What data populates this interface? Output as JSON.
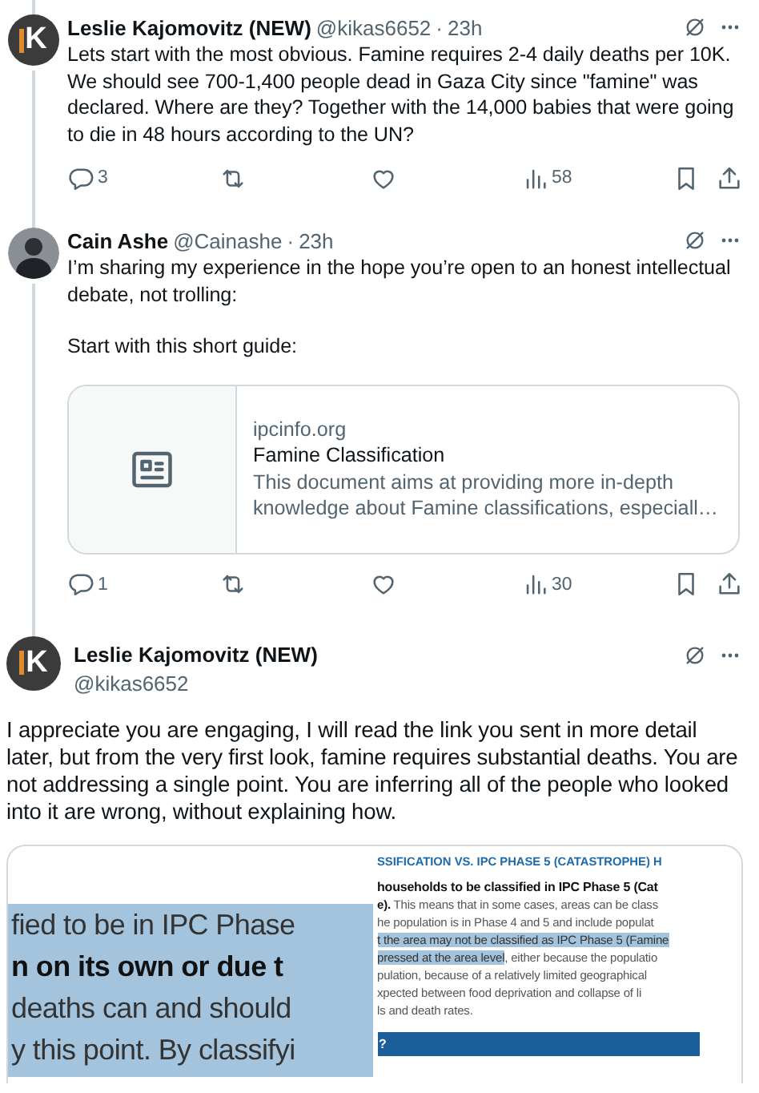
{
  "tweets": [
    {
      "kind": "reply",
      "author": "Leslie Kajomovitz (NEW)",
      "handle": "@kikas6652",
      "separator": "·",
      "time": "23h",
      "avatar": {
        "kind": "logo",
        "mark": "K"
      },
      "paragraphs": [
        "Lets start with the most obvious. Famine requires 2-4 daily deaths per 10K. We should see 700-1,400 people dead in Gaza City since \"famine\" was declared. Where are they? Together with the 14,000 babies that were going to die in 48 hours according to the UN?"
      ],
      "stats": {
        "replies": "3",
        "views": "58"
      }
    },
    {
      "kind": "reply",
      "author": "Cain Ashe",
      "handle": "@Cainashe",
      "separator": "·",
      "time": "23h",
      "avatar": {
        "kind": "photo"
      },
      "paragraphs": [
        "I’m sharing my experience in the hope you’re open to an honest intellectual debate, not trolling:",
        "Start with this short guide:"
      ],
      "link_card": {
        "domain": "ipcinfo.org",
        "title": "Famine Classification",
        "description": "This document aims at providing more in-depth knowledge about Famine classifications, especiall…"
      },
      "stats": {
        "replies": "1",
        "views": "30"
      }
    },
    {
      "kind": "focus",
      "author": "Leslie Kajomovitz (NEW)",
      "handle": "@kikas6652",
      "avatar": {
        "kind": "logo",
        "mark": "K"
      },
      "paragraphs": [
        "I appreciate you are engaging, I will read the link you sent in more detail later, but from the very first look, famine requires substantial deaths. You are not addressing a single point. You are inferring all of the people who looked into it are wrong, without explaining how."
      ],
      "images": [
        {
          "kind": "zoomed_text",
          "lines": [
            {
              "text": "fied to be in IPC Phase",
              "bold": false
            },
            {
              "text": "n on its own or due t",
              "bold": true
            },
            {
              "text": "deaths can and should",
              "bold": false
            },
            {
              "text": "y this point. By classifyi",
              "bold": false
            }
          ]
        },
        {
          "kind": "document_page",
          "heading": "SSIFICATION VS. IPC PHASE 5 (CATASTROPHE) H",
          "lines": [
            {
              "segments": [
                {
                  "text": "**households to be classified in IPC Phase 5 (Cat**",
                  "highlighted": false
                }
              ]
            },
            {
              "segments": [
                {
                  "text": "**e).** This means that in some cases, areas can be class",
                  "highlighted": false
                }
              ]
            },
            {
              "segments": [
                {
                  "text": "he population is in Phase 4 and 5 and include populat",
                  "highlighted": false
                }
              ]
            },
            {
              "segments": [
                {
                  "text": "t the area may not be classified as IPC Phase 5 (Famine",
                  "highlighted": true
                }
              ]
            },
            {
              "segments": [
                {
                  "text": "pressed at the area level",
                  "highlighted": true
                },
                {
                  "text": ", either because the populatio",
                  "highlighted": false
                }
              ]
            },
            {
              "segments": [
                {
                  "text": "pulation, because of a relatively limited geographical",
                  "highlighted": false
                }
              ]
            },
            {
              "segments": [
                {
                  "text": "xpected between food deprivation and collapse of li",
                  "highlighted": false
                }
              ]
            },
            {
              "segments": [
                {
                  "text": "ls and death rates.",
                  "highlighted": false
                }
              ]
            }
          ],
          "band": "?"
        }
      ]
    }
  ]
}
